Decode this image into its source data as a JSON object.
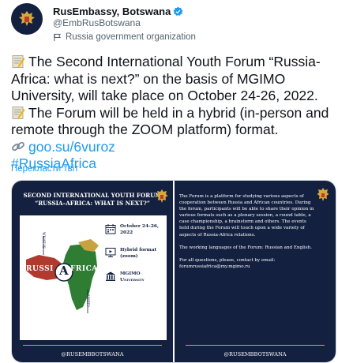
{
  "author": {
    "display_name": "RusEmbassy, Botswana",
    "handle": "@EmbRusBotswana",
    "label": "Russia government organization"
  },
  "tweet": {
    "line1": "The Second International Youth Forum “Russia-",
    "line2": "Africa: what is next?” on the basis of MGIMO",
    "line3": "University, will take place on October 24-26, 2022.",
    "line4": "The Forum will be held in a hybrid (in-person and",
    "line5": "remote through the ZOOM platform) format.",
    "link": "goo.su/6vuroz",
    "hashtag": "#RussiaAfrica",
    "translate": "Перекласти твіт"
  },
  "card1": {
    "title_line1": "SECOND INTERNATIONAL YOUTH FORUM",
    "title_line2": "“RUSSIA–AFRICA: WHAT IS NEXT?”",
    "map_text_left": "RUSSI",
    "map_text_right": "FRICA",
    "map_letter": "A",
    "map_caption_top": "WHAT IS",
    "map_caption_bottom": "NEXT?",
    "date": "October 24–26, 2022",
    "format": "Hybrid format (zoom)",
    "venue_line1": "MGIMO",
    "venue_line2": "University",
    "footer": "@RUSEMBBOTSWANA"
  },
  "card2": {
    "paragraph1": "The Forum is a platform for studying various aspects of cooperation between Russia and African countries. During the forum, participants will be able to share their opinion in various formats such as a plenary session, a round table, a case championship, a brainstorm and others. The events held during the Forum will touch upon a wide variety of aspects of Russia-Africa relations.",
    "paragraph2": "The working languages of the Forum: Russian and English.",
    "paragraph3": "For all questions, please, contact by email: forumrussiafrica@my.mgimo.ru",
    "footer": "@RUSEMBBOTSWANA"
  },
  "colors": {
    "navy": "#14203f",
    "link_blue": "#1d9bf0",
    "gold": "#c9a94e",
    "map_red": "#c0392b",
    "map_green": "#2e7d32"
  }
}
